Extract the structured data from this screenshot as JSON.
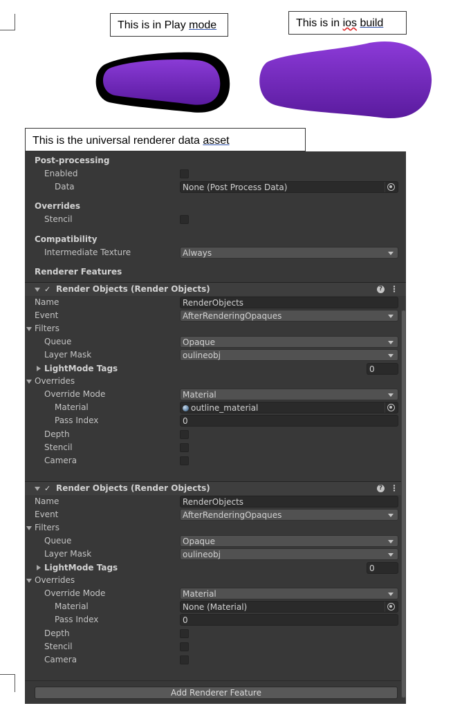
{
  "captions": {
    "play_prefix": "This is in Play ",
    "play_underlined": "mode",
    "ios_prefix": "This is in ",
    "ios_squiggle": "ios",
    "ios_underlined": "build",
    "asset_prefix": "This is the universal renderer data ",
    "asset_underlined": "asset"
  },
  "colors": {
    "capsule_purple": "#7a2bc4",
    "outline": "#000000",
    "inspector_bg": "#383838"
  },
  "post_processing": {
    "title": "Post-processing",
    "enabled_label": "Enabled",
    "data_label": "Data",
    "data_value": "None (Post Process Data)"
  },
  "overrides": {
    "title": "Overrides",
    "stencil_label": "Stencil"
  },
  "compatibility": {
    "title": "Compatibility",
    "intermediate_label": "Intermediate Texture",
    "intermediate_value": "Always"
  },
  "renderer_features_title": "Renderer Features",
  "features": [
    {
      "title": "Render Objects (Render Objects)",
      "help": "?",
      "menu": "⋮",
      "name_label": "Name",
      "name_value": "RenderObjects",
      "event_label": "Event",
      "event_value": "AfterRenderingOpaques",
      "filters_label": "Filters",
      "queue_label": "Queue",
      "queue_value": "Opaque",
      "layer_mask_label": "Layer Mask",
      "layer_mask_value": "oulineobj",
      "lightmode_label": "LightMode Tags",
      "lightmode_value": "0",
      "overrides_label": "Overrides",
      "override_mode_label": "Override Mode",
      "override_mode_value": "Material",
      "material_label": "Material",
      "material_value": "outline_material",
      "pass_index_label": "Pass Index",
      "pass_index_value": "0",
      "depth_label": "Depth",
      "stencil_label": "Stencil",
      "camera_label": "Camera"
    },
    {
      "title": "Render Objects (Render Objects)",
      "help": "?",
      "menu": "⋮",
      "name_label": "Name",
      "name_value": "RenderObjects",
      "event_label": "Event",
      "event_value": "AfterRenderingOpaques",
      "filters_label": "Filters",
      "queue_label": "Queue",
      "queue_value": "Opaque",
      "layer_mask_label": "Layer Mask",
      "layer_mask_value": "oulineobj",
      "lightmode_label": "LightMode Tags",
      "lightmode_value": "0",
      "overrides_label": "Overrides",
      "override_mode_label": "Override Mode",
      "override_mode_value": "Material",
      "material_label": "Material",
      "material_value": "None (Material)",
      "pass_index_label": "Pass Index",
      "pass_index_value": "0",
      "depth_label": "Depth",
      "stencil_label": "Stencil",
      "camera_label": "Camera"
    }
  ],
  "add_button_label": "Add Renderer Feature"
}
